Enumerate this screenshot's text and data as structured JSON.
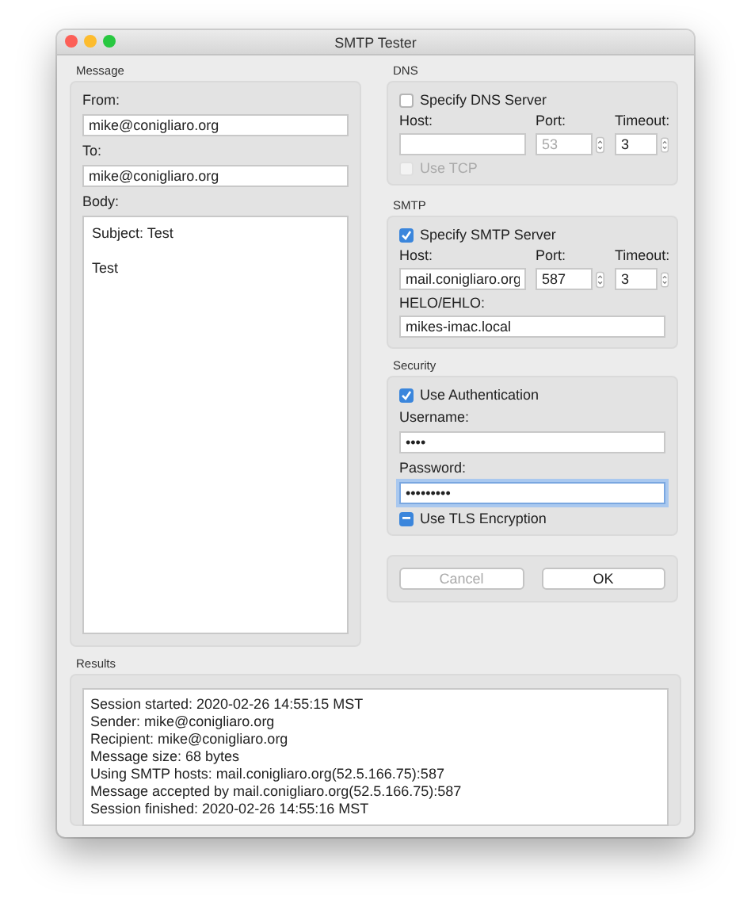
{
  "window": {
    "title": "SMTP Tester"
  },
  "message": {
    "label": "Message",
    "from_label": "From:",
    "from_value": "mike@conigliaro.org",
    "to_label": "To:",
    "to_value": "mike@conigliaro.org",
    "body_label": "Body:",
    "body_lines": [
      "Subject: Test",
      "Test"
    ]
  },
  "dns": {
    "label": "DNS",
    "specify": {
      "label": "Specify DNS Server",
      "checked": false
    },
    "host_label": "Host:",
    "port_label": "Port:",
    "timeout_label": "Timeout:",
    "port_value": "53",
    "port_disabled": true,
    "timeout_value": "3",
    "use_tcp": {
      "label": "Use TCP",
      "checked": false,
      "disabled": true
    }
  },
  "smtp": {
    "label": "SMTP",
    "specify": {
      "label": "Specify SMTP Server",
      "checked": true
    },
    "host_label": "Host:",
    "port_label": "Port:",
    "timeout_label": "Timeout:",
    "host_value": "mail.conigliaro.org",
    "port_value": "587",
    "timeout_value": "3",
    "helo_label": "HELO/EHLO:",
    "helo_value": "mikes-imac.local"
  },
  "security": {
    "label": "Security",
    "use_auth": {
      "label": "Use Authentication",
      "checked": true
    },
    "username_label": "Username:",
    "username_value": "••••",
    "password_label": "Password:",
    "password_value": "•••••••••",
    "password_focused": true,
    "use_tls": {
      "label": "Use TLS Encryption",
      "checked": true,
      "mixed": true
    }
  },
  "buttons": [
    {
      "label": "Cancel",
      "disabled": true
    },
    {
      "label": "OK",
      "disabled": false
    }
  ],
  "results": {
    "label": "Results",
    "lines": [
      "Session started: 2020-02-26 14:55:15 MST",
      "Sender: mike@conigliaro.org",
      "Recipient: mike@conigliaro.org",
      "Message size: 68 bytes",
      "Using SMTP hosts: mail.conigliaro.org(52.5.166.75):587",
      "Message accepted by mail.conigliaro.org(52.5.166.75):587",
      "Session finished: 2020-02-26 14:55:16 MST"
    ]
  }
}
